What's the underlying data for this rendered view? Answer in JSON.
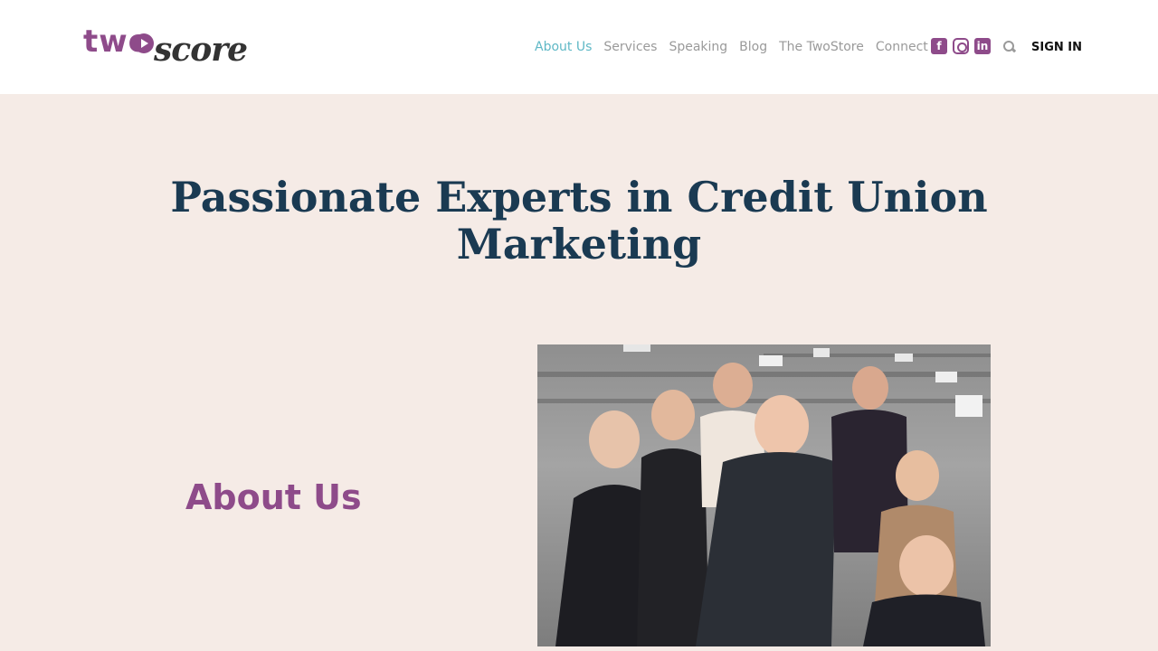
{
  "logo": {
    "part1": "two",
    "part2": "score"
  },
  "nav": {
    "items": [
      {
        "label": "About Us",
        "active": true
      },
      {
        "label": "Services"
      },
      {
        "label": "Speaking"
      },
      {
        "label": "Blog"
      },
      {
        "label": "The TwoStore"
      },
      {
        "label": "Connect"
      }
    ],
    "social": [
      {
        "icon": "facebook-icon",
        "glyph": "f"
      },
      {
        "icon": "instagram-icon",
        "glyph": ""
      },
      {
        "icon": "linkedin-icon",
        "glyph": "in"
      }
    ],
    "sign_in": "SIGN IN"
  },
  "hero": {
    "title": "Passionate Experts in Credit Union Marketing"
  },
  "about": {
    "heading": "About Us"
  },
  "colors": {
    "brand_purple": "#8e4b8a",
    "navy": "#1a3a52",
    "teal_active": "#5fb8c6",
    "page_bg": "#f5ebe6"
  }
}
